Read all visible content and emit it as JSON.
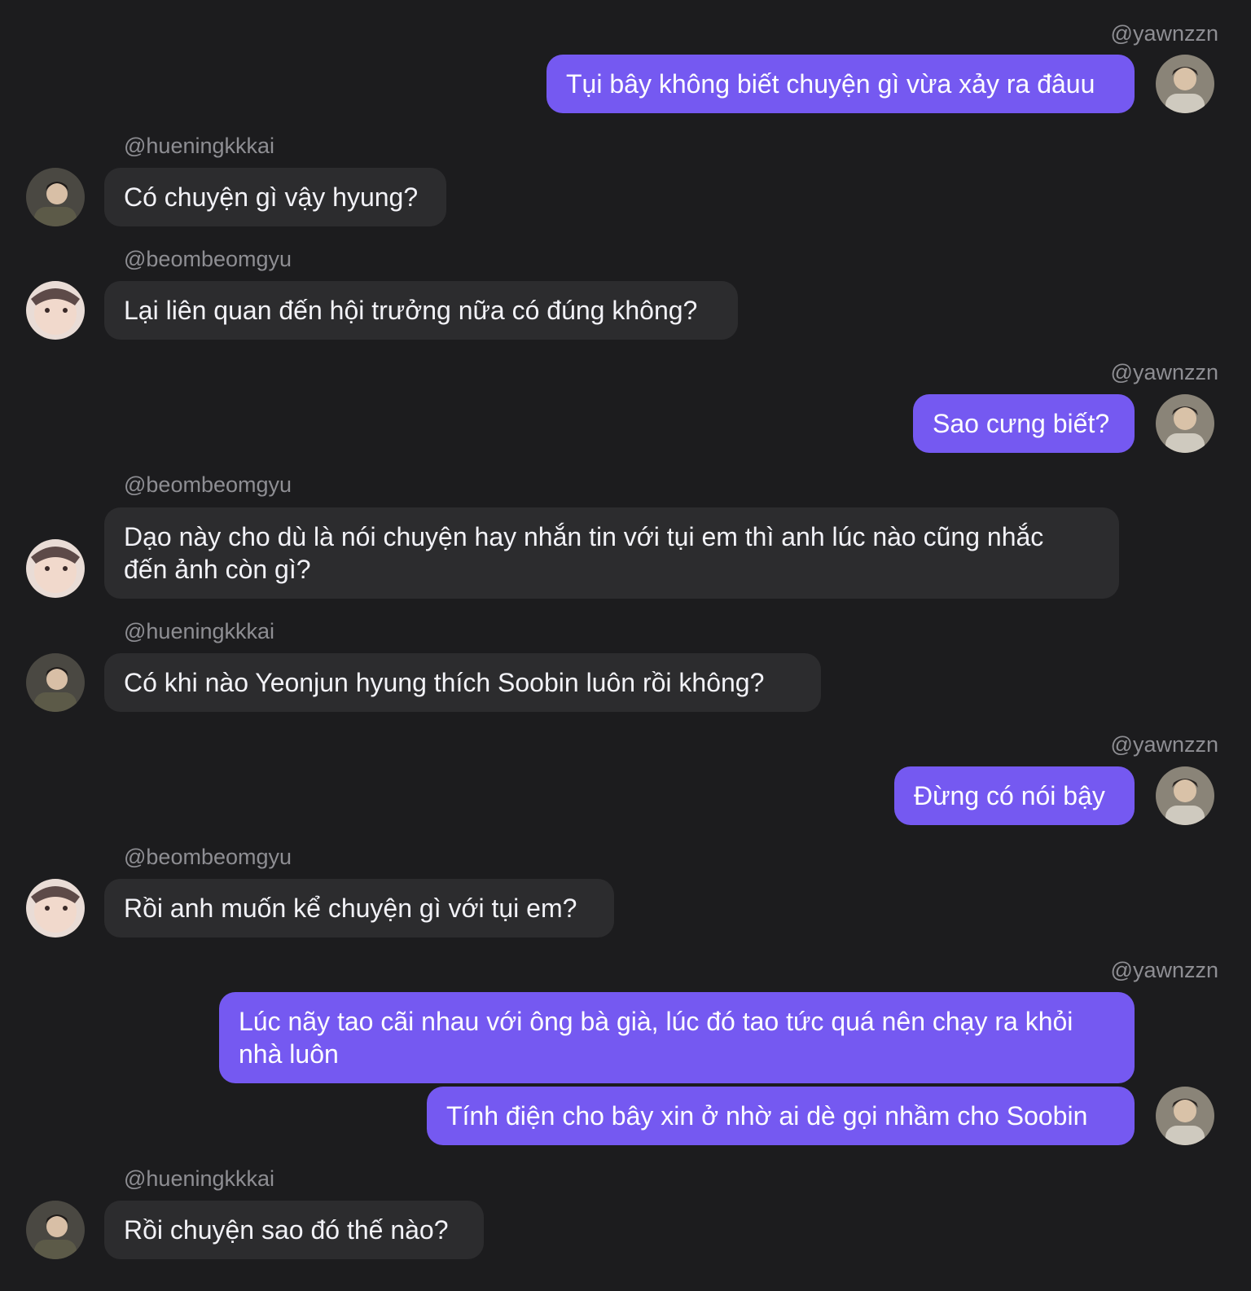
{
  "messages": [
    {
      "user": "@yawnzzn",
      "text": "Tụi bây không biết chuyện gì vừa xảy ra đâuu",
      "side": "out",
      "avatar": "yawnzzn-avatar"
    },
    {
      "user": "@hueningkkkai",
      "text": "Có chuyện gì vậy hyung?",
      "side": "in",
      "avatar": "hueningkkkai-avatar"
    },
    {
      "user": "@beombeomgyu",
      "text": "Lại liên quan đến hội trưởng nữa có đúng không?",
      "side": "in",
      "avatar": "beombeomgyu-avatar"
    },
    {
      "user": "@yawnzzn",
      "text": "Sao cưng biết?",
      "side": "out",
      "avatar": "yawnzzn-avatar"
    },
    {
      "user": "@beombeomgyu",
      "text": "Dạo này cho dù là nói chuyện hay nhắn tin với tụi em thì anh lúc nào cũng nhắc đến ảnh còn gì?",
      "side": "in",
      "avatar": "beombeomgyu-avatar"
    },
    {
      "user": "@hueningkkkai",
      "text": "Có khi nào Yeonjun hyung thích Soobin luôn rồi không?",
      "side": "in",
      "avatar": "hueningkkkai-avatar"
    },
    {
      "user": "@yawnzzn",
      "text": "Đừng có nói bậy",
      "side": "out",
      "avatar": "yawnzzn-avatar"
    },
    {
      "user": "@beombeomgyu",
      "text": "Rồi anh muốn kể chuyện gì với tụi em?",
      "side": "in",
      "avatar": "beombeomgyu-avatar"
    },
    {
      "user": "@yawnzzn",
      "text": "Lúc nãy tao cãi nhau với ông bà già, lúc đó tao tức quá nên chạy ra khỏi nhà luôn",
      "side": "out",
      "avatar": "yawnzzn-avatar"
    },
    {
      "user": "",
      "text": "Tính điện cho bây xin ở nhờ ai dè gọi nhầm cho Soobin",
      "side": "out",
      "avatar": "yawnzzn-avatar"
    },
    {
      "user": "@hueningkkkai",
      "text": "Rồi chuyện sao đó thế nào?",
      "side": "in",
      "avatar": "hueningkkkai-avatar"
    }
  ],
  "colors": {
    "background": "#1c1c1e",
    "incoming_bubble": "#2c2c2e",
    "outgoing_bubble": "#7559f1",
    "username": "#8e8e93"
  }
}
